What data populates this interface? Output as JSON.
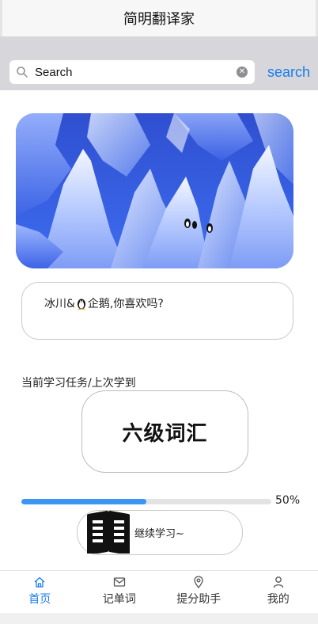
{
  "nav": {
    "title": "简明翻译家"
  },
  "search": {
    "placeholder": "Search",
    "value": "Search",
    "button_label": "search"
  },
  "banner": {
    "image": "glacier-penguin-photo"
  },
  "caption": {
    "before": "冰川&",
    "after": "企鹅,你喜欢吗?"
  },
  "task": {
    "label": "当前学习任务/上次学到",
    "vocab": "六级词汇"
  },
  "progress": {
    "value": 0.5,
    "label": "50%"
  },
  "continue": {
    "label": "继续学习~"
  },
  "tabs": [
    {
      "label": "首页",
      "icon": "home-icon",
      "active": true
    },
    {
      "label": "记单词",
      "icon": "mail-icon",
      "active": false
    },
    {
      "label": "提分助手",
      "icon": "location-icon",
      "active": false
    },
    {
      "label": "我的",
      "icon": "user-icon",
      "active": false
    }
  ],
  "colors": {
    "accent": "#1a7cf0",
    "progress": "#3c95f2",
    "search_bg": "#d6d6db"
  }
}
